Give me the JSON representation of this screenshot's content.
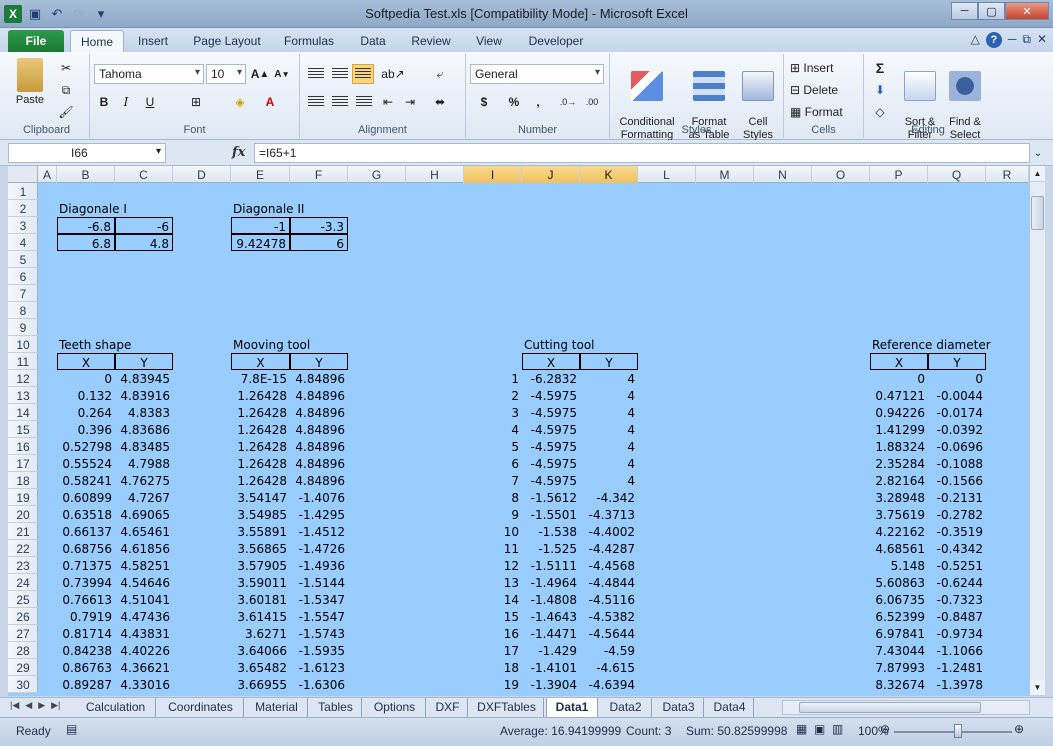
{
  "window": {
    "title": "Softpedia Test.xls  [Compatibility Mode]  -  Microsoft Excel",
    "logo_letter": "X"
  },
  "ribbon_tabs": [
    "File",
    "Home",
    "Insert",
    "Page Layout",
    "Formulas",
    "Data",
    "Review",
    "View",
    "Developer"
  ],
  "ribbon": {
    "clipboard": {
      "paste": "Paste",
      "label": "Clipboard"
    },
    "font": {
      "name": "Tahoma",
      "size": "10",
      "bold": "B",
      "italic": "I",
      "underline": "U",
      "label": "Font"
    },
    "alignment": {
      "label": "Alignment"
    },
    "number": {
      "format": "General",
      "currency": "$",
      "percent": "%",
      "comma": ",",
      "label": "Number"
    },
    "styles": {
      "conditional": "Conditional\nFormatting",
      "table": "Format\nas Table",
      "cell": "Cell\nStyles",
      "label": "Styles"
    },
    "cells": {
      "insert": "Insert",
      "delete": "Delete",
      "format": "Format",
      "label": "Cells"
    },
    "editing": {
      "sort": "Sort &\nFilter",
      "find": "Find &\nSelect",
      "label": "Editing",
      "sum": "Σ"
    }
  },
  "formula_bar": {
    "name_box": "I66",
    "fx": "fx",
    "formula": "=I65+1"
  },
  "columns": [
    "A",
    "B",
    "C",
    "D",
    "E",
    "F",
    "G",
    "H",
    "I",
    "J",
    "K",
    "L",
    "M",
    "N",
    "O",
    "P",
    "Q",
    "R"
  ],
  "selected_columns": [
    "I",
    "J",
    "K"
  ],
  "rows": [
    1,
    2,
    3,
    4,
    5,
    6,
    7,
    8,
    9,
    10,
    11,
    12,
    13,
    14,
    15,
    16,
    17,
    18,
    19,
    20,
    21,
    22,
    23,
    24,
    25,
    26,
    27,
    28,
    29,
    30
  ],
  "sections": {
    "diag1": {
      "title": "Diagonale I",
      "rows": [
        [
          "-6.8",
          "-6"
        ],
        [
          "6.8",
          "4.8"
        ]
      ]
    },
    "diag2": {
      "title": "Diagonale II",
      "rows": [
        [
          "-1",
          "-3.3"
        ],
        [
          "9.42478",
          "6"
        ]
      ]
    },
    "teeth": {
      "title": "Teeth shape",
      "hx": "X",
      "hy": "Y",
      "x": [
        "0",
        "0.132",
        "0.264",
        "0.396",
        "0.52798",
        "0.55524",
        "0.58241",
        "0.60899",
        "0.63518",
        "0.66137",
        "0.68756",
        "0.71375",
        "0.73994",
        "0.76613",
        "0.7919",
        "0.81714",
        "0.84238",
        "0.86763",
        "0.89287"
      ],
      "y": [
        "4.83945",
        "4.83916",
        "4.8383",
        "4.83686",
        "4.83485",
        "4.7988",
        "4.76275",
        "4.7267",
        "4.69065",
        "4.65461",
        "4.61856",
        "4.58251",
        "4.54646",
        "4.51041",
        "4.47436",
        "4.43831",
        "4.40226",
        "4.36621",
        "4.33016"
      ]
    },
    "mooving": {
      "title": "Mooving tool",
      "hx": "X",
      "hy": "Y",
      "x": [
        "7.8E-15",
        "1.26428",
        "1.26428",
        "1.26428",
        "1.26428",
        "1.26428",
        "1.26428",
        "3.54147",
        "3.54985",
        "3.55891",
        "3.56865",
        "3.57905",
        "3.59011",
        "3.60181",
        "3.61415",
        "3.6271",
        "3.64066",
        "3.65482",
        "3.66955"
      ],
      "y": [
        "4.84896",
        "4.84896",
        "4.84896",
        "4.84896",
        "4.84896",
        "4.84896",
        "4.84896",
        "-1.4076",
        "-1.4295",
        "-1.4512",
        "-1.4726",
        "-1.4936",
        "-1.5144",
        "-1.5347",
        "-1.5547",
        "-1.5743",
        "-1.5935",
        "-1.6123",
        "-1.6306"
      ]
    },
    "cutting": {
      "title": "Cutting tool",
      "hx": "X",
      "hy": "Y",
      "n": [
        "1",
        "2",
        "3",
        "4",
        "5",
        "6",
        "7",
        "8",
        "9",
        "10",
        "11",
        "12",
        "13",
        "14",
        "15",
        "16",
        "17",
        "18",
        "19"
      ],
      "x": [
        "-6.2832",
        "-4.5975",
        "-4.5975",
        "-4.5975",
        "-4.5975",
        "-4.5975",
        "-4.5975",
        "-1.5612",
        "-1.5501",
        "-1.538",
        "-1.525",
        "-1.5111",
        "-1.4964",
        "-1.4808",
        "-1.4643",
        "-1.4471",
        "-1.429",
        "-1.4101",
        "-1.3904"
      ],
      "y": [
        "4",
        "4",
        "4",
        "4",
        "4",
        "4",
        "4",
        "-4.342",
        "-4.3713",
        "-4.4002",
        "-4.4287",
        "-4.4568",
        "-4.4844",
        "-4.5116",
        "-4.5382",
        "-4.5644",
        "-4.59",
        "-4.615",
        "-4.6394"
      ]
    },
    "refdiam": {
      "title": "Reference diameter",
      "hx": "X",
      "hy": "Y",
      "x": [
        "0",
        "0.47121",
        "0.94226",
        "1.41299",
        "1.88324",
        "2.35284",
        "2.82164",
        "3.28948",
        "3.75619",
        "4.22162",
        "4.68561",
        "5.148",
        "5.60863",
        "6.06735",
        "6.52399",
        "6.97841",
        "7.43044",
        "7.87993",
        "8.32674"
      ],
      "y": [
        "0",
        "-0.0044",
        "-0.0174",
        "-0.0392",
        "-0.0696",
        "-0.1088",
        "-0.1566",
        "-0.2131",
        "-0.2782",
        "-0.3519",
        "-0.4342",
        "-0.5251",
        "-0.6244",
        "-0.7323",
        "-0.8487",
        "-0.9734",
        "-1.1066",
        "-1.2481",
        "-1.3978"
      ]
    }
  },
  "sheet_tabs": [
    "Calculation",
    "Coordinates",
    "Material",
    "Tables",
    "Options",
    "DXF",
    "DXFTables",
    "Data1",
    "Data2",
    "Data3",
    "Data4"
  ],
  "active_sheet": "Data1",
  "status": {
    "ready": "Ready",
    "average": "Average: 16.94199999",
    "count": "Count: 3",
    "sum": "Sum: 50.82599998",
    "zoom": "100%"
  }
}
